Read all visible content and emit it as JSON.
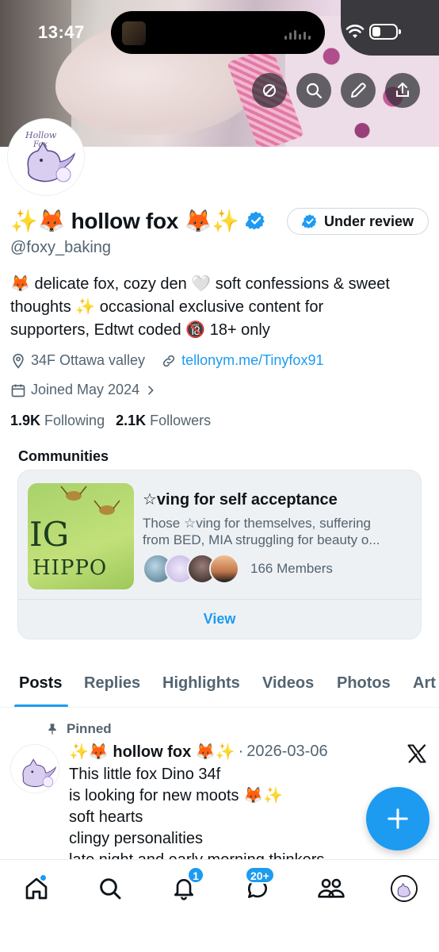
{
  "status_bar": {
    "time": "13:47"
  },
  "profile": {
    "display_name": "✨🦊 hollow fox 🦊✨",
    "handle": "@foxy_baking",
    "review_button": "Under review",
    "bio_lines": [
      "🦊 delicate fox, cozy den 🤍 soft confessions & sweet",
      "thoughts ✨ occasional exclusive content for",
      "supporters, Edtwt coded 🔞 18+ only"
    ],
    "location": "34F Ottawa valley",
    "link": "tellonym.me/Tinyfox91",
    "joined": "Joined May 2024",
    "following_count": "1.9K",
    "following_label": "Following",
    "followers_count": "2.1K",
    "followers_label": "Followers",
    "avatar_text": [
      "Hollow",
      "Fox"
    ]
  },
  "communities": {
    "title": "Communities",
    "card": {
      "name": "☆ving for self acceptance",
      "desc_line1": "Those ☆ving for themselves, suffering",
      "desc_line2": "from BED, MIA struggling for beauty o...",
      "members": "166 Members",
      "view_label": "View",
      "thumb_text_1": "IG",
      "thumb_text_2": "HIPPO"
    }
  },
  "tabs": [
    "Posts",
    "Replies",
    "Highlights",
    "Videos",
    "Photos",
    "Art"
  ],
  "post": {
    "pinned_label": "Pinned",
    "name": "✨🦊 hollow fox 🦊✨",
    "separator": "·",
    "date": "2026-03-06",
    "lines": [
      "This little fox Dino 34f",
      "is looking for new moots 🦊✨",
      "soft hearts",
      "clingy personalities",
      "late night and early morning thinkers"
    ]
  },
  "bottom_nav": {
    "notifications_badge": "1",
    "messages_badge": "20+"
  },
  "colors": {
    "accent": "#1d9bf0",
    "text": "#0f1419",
    "secondary": "#536471"
  }
}
